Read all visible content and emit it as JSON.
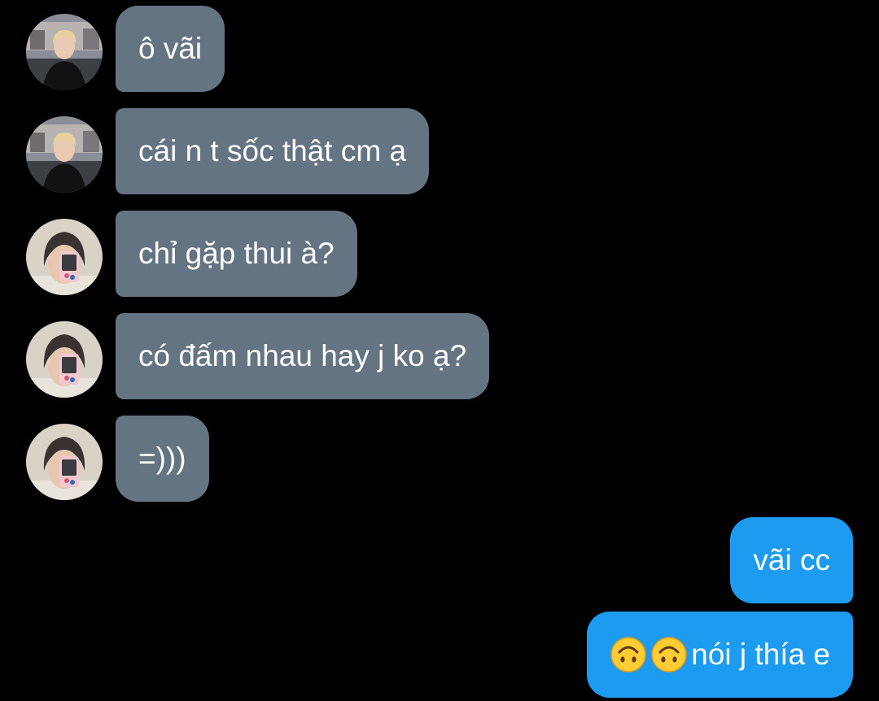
{
  "colors": {
    "background": "#000000",
    "incoming_bubble": "#647482",
    "outgoing_bubble": "#1d9bf0",
    "text": "#ffffff"
  },
  "messages": {
    "incoming": [
      {
        "text": "ô vãi",
        "avatar": "avatar-blond-guy"
      },
      {
        "text": "cái n t sốc thật cm ạ",
        "avatar": "avatar-blond-guy"
      },
      {
        "text": "chỉ gặp thui à?",
        "avatar": "avatar-mirror-selfie"
      },
      {
        "text": "có đấm nhau hay j ko ạ?",
        "avatar": "avatar-mirror-selfie"
      },
      {
        "text": "=)))",
        "avatar": "avatar-mirror-selfie"
      }
    ],
    "outgoing": [
      {
        "text": "vãi cc"
      },
      {
        "emoji": "upside-down-face-icon",
        "text": "nói j thía e"
      }
    ]
  }
}
